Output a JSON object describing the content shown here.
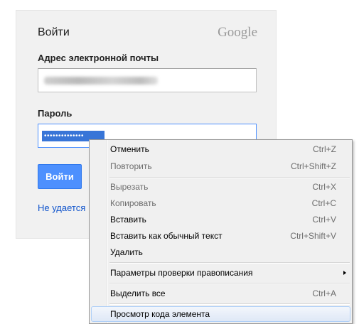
{
  "login": {
    "title": "Войти",
    "brand": "Google",
    "email_label": "Адрес электронной почты",
    "password_label": "Пароль",
    "password_value": "••••••••••••••",
    "signin_label": "Войти",
    "trouble_link": "Не удается"
  },
  "context_menu": {
    "items": [
      {
        "label": "Отменить",
        "shortcut": "Ctrl+Z"
      },
      {
        "label": "Повторить",
        "shortcut": "Ctrl+Shift+Z"
      },
      {
        "label": "Вырезать",
        "shortcut": "Ctrl+X"
      },
      {
        "label": "Копировать",
        "shortcut": "Ctrl+C"
      },
      {
        "label": "Вставить",
        "shortcut": "Ctrl+V"
      },
      {
        "label": "Вставить как обычный текст",
        "shortcut": "Ctrl+Shift+V"
      },
      {
        "label": "Удалить",
        "shortcut": ""
      },
      {
        "label": "Параметры проверки правописания",
        "shortcut": ""
      },
      {
        "label": "Выделить все",
        "shortcut": "Ctrl+A"
      },
      {
        "label": "Просмотр кода элемента",
        "shortcut": ""
      }
    ]
  },
  "colors": {
    "accent_button": "#4d90fe",
    "link": "#1155cc",
    "selection": "#3875d7"
  }
}
